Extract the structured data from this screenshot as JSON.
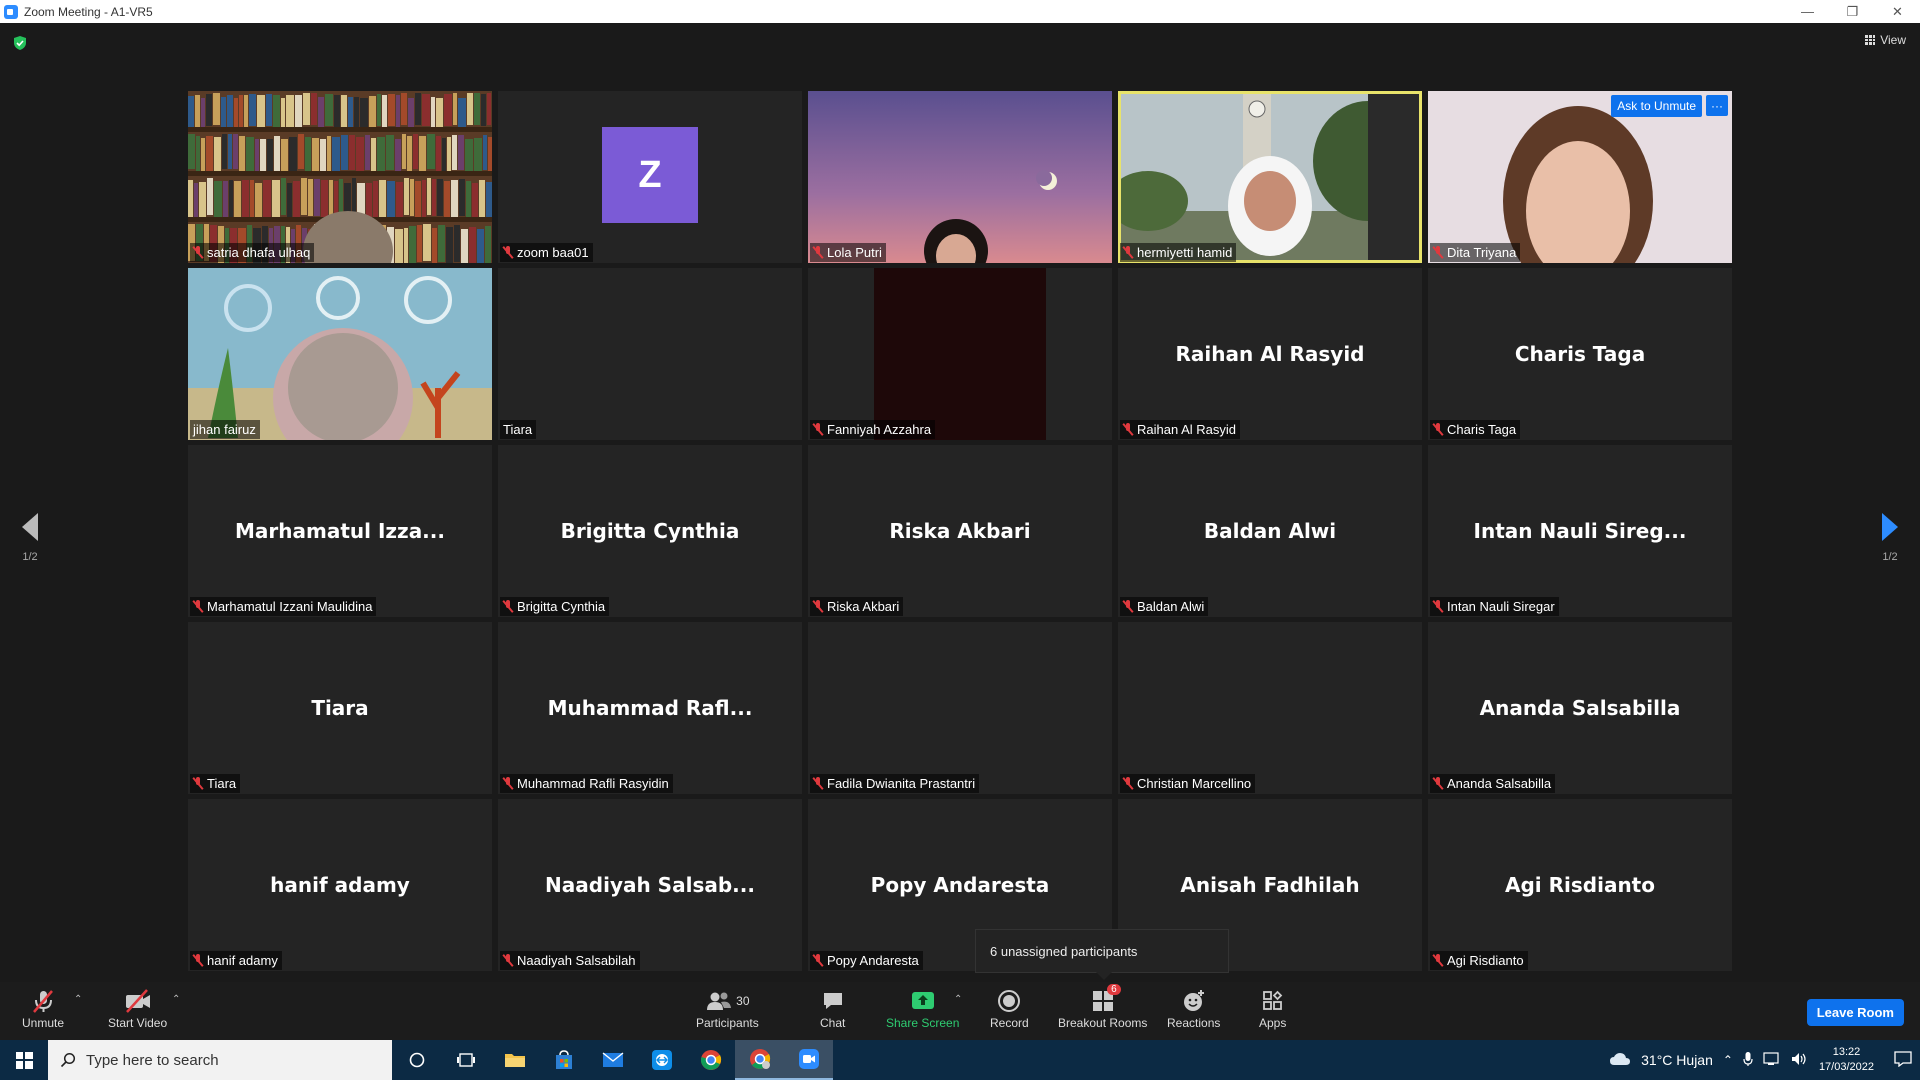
{
  "window": {
    "title": "Zoom Meeting - A1-VR5",
    "controls": [
      "—",
      "❐",
      "✕"
    ]
  },
  "meeting": {
    "view_label": "View",
    "page_indicator_left": "1/2",
    "page_indicator_right": "1/2",
    "avatar_letter": "Z",
    "ask_to_unmute": "Ask to Unmute",
    "more": "···",
    "tooltip": "6 unassigned participants",
    "tiles": [
      {
        "label": "satria dhafa ulhaq",
        "big": "",
        "kind": "video-bookshelf"
      },
      {
        "label": "zoom baa01",
        "big": "",
        "kind": "avatar"
      },
      {
        "label": "Lola Putri",
        "big": "",
        "kind": "video-sky"
      },
      {
        "label": "hermiyetti hamid",
        "big": "",
        "kind": "video-outdoor"
      },
      {
        "label": "Dita Triyana",
        "big": "",
        "kind": "video-person"
      },
      {
        "label": "jihan fairuz",
        "big": "",
        "kind": "video-sea"
      },
      {
        "label": "Tiara",
        "big": "",
        "kind": "blank"
      },
      {
        "label": "Fanniyah Azzahra",
        "big": "",
        "kind": "video-dark"
      },
      {
        "label": "Raihan Al Rasyid",
        "big": "Raihan Al Rasyid",
        "kind": "name"
      },
      {
        "label": "Charis Taga",
        "big": "Charis Taga",
        "kind": "name"
      },
      {
        "label": "Marhamatul Izzani Maulidina",
        "big": "Marhamatul  Izza...",
        "kind": "name"
      },
      {
        "label": "Brigitta Cynthia",
        "big": "Brigitta Cynthia",
        "kind": "name"
      },
      {
        "label": "Riska Akbari",
        "big": "Riska Akbari",
        "kind": "name"
      },
      {
        "label": "Baldan Alwi",
        "big": "Baldan Alwi",
        "kind": "name"
      },
      {
        "label": "Intan Nauli Siregar",
        "big": "Intan  Nauli  Sireg...",
        "kind": "name"
      },
      {
        "label": "Tiara",
        "big": "Tiara",
        "kind": "name"
      },
      {
        "label": "Muhammad Rafli Rasyidin",
        "big": "Muhammad  Rafl...",
        "kind": "name"
      },
      {
        "label": "Fadila Dwianita Prastantri",
        "big": "",
        "kind": "blank"
      },
      {
        "label": "Christian Marcellino",
        "big": "",
        "kind": "blank"
      },
      {
        "label": "Ananda Salsabilla",
        "big": "Ananda Salsabilla",
        "kind": "name"
      },
      {
        "label": "hanif adamy",
        "big": "hanif adamy",
        "kind": "name"
      },
      {
        "label": "Naadiyah Salsabilah",
        "big": "Naadiyah  Salsab...",
        "kind": "name"
      },
      {
        "label": "Popy Andaresta",
        "big": "Popy Andaresta",
        "kind": "name"
      },
      {
        "label": "",
        "big": "Anisah Fadhilah",
        "kind": "name"
      },
      {
        "label": "Agi Risdianto",
        "big": "Agi Risdianto",
        "kind": "name"
      }
    ]
  },
  "toolbar": {
    "unmute": "Unmute",
    "start_video": "Start Video",
    "participants": "Participants",
    "participants_count": "30",
    "chat": "Chat",
    "share_screen": "Share Screen",
    "record": "Record",
    "breakout_rooms": "Breakout Rooms",
    "breakout_badge": "6",
    "reactions": "Reactions",
    "apps": "Apps",
    "leave_room": "Leave Room"
  },
  "taskbar": {
    "search_placeholder": "Type here to search",
    "weather": "31°C  Hujan",
    "time": "13:22",
    "date": "17/03/2022"
  },
  "colors": {
    "accent_blue": "#0e72ed",
    "share_green": "#2ecc71",
    "mute_red": "#e0393e",
    "active_speaker": "#e8e36a"
  }
}
